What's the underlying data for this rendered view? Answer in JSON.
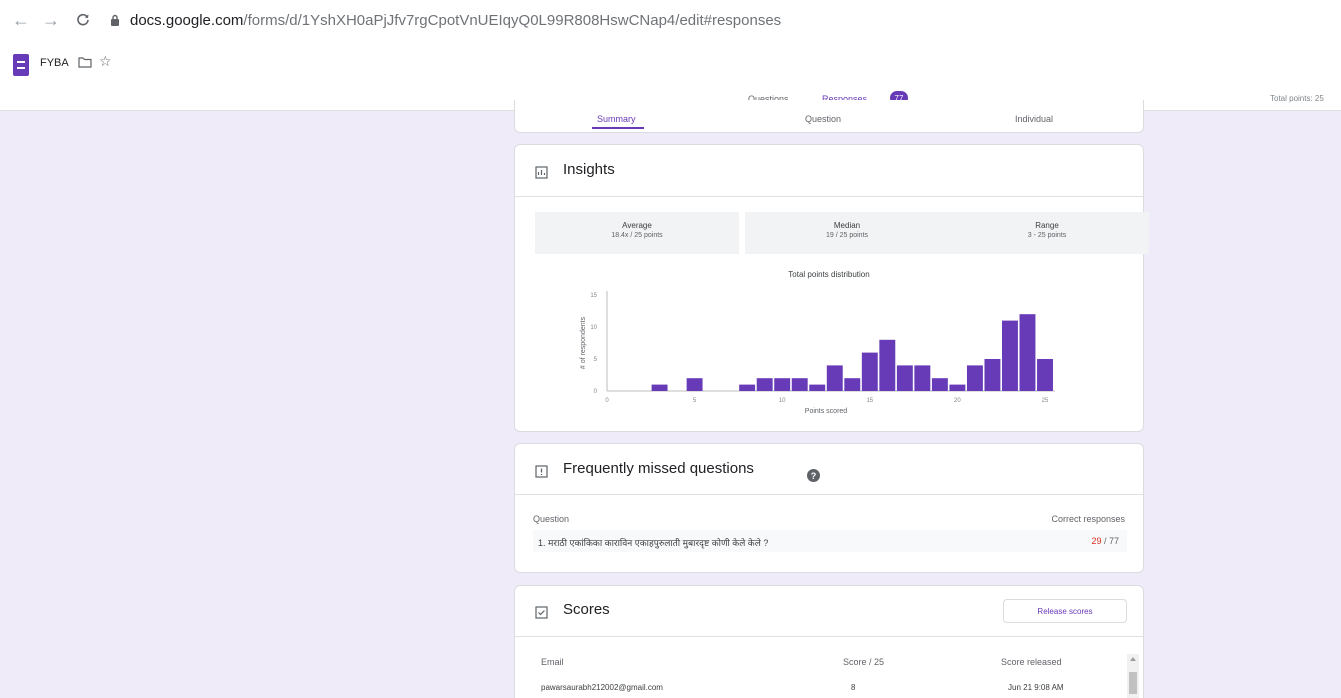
{
  "browser": {
    "url_domain": "docs.google.com",
    "url_path": "/forms/d/1YshXH0aPjJfv7rgCpotVnUEIqyQ0L99R808HswCNap4/edit#responses"
  },
  "header": {
    "form_title": "FYBA",
    "tabs": {
      "questions": "Questions",
      "responses": "Responses",
      "responses_count": "77"
    },
    "total_points": "Total points: 25"
  },
  "subtabs": [
    "Summary",
    "Question",
    "Individual"
  ],
  "insights": {
    "title": "Insights",
    "stats": [
      {
        "label": "Average",
        "value": "18.4x / 25 points"
      },
      {
        "label": "Median",
        "value": "19 / 25 points"
      },
      {
        "label": "Range",
        "value": "3 - 25 points"
      }
    ]
  },
  "chart_data": {
    "type": "bar",
    "title": "Total points distribution",
    "xlabel": "Points scored",
    "ylabel": "# of respondents",
    "xlim": [
      0,
      25
    ],
    "ylim": [
      0,
      15
    ],
    "xticks": [
      0,
      5,
      10,
      15,
      20,
      25
    ],
    "yticks": [
      0,
      5,
      10,
      15
    ],
    "x": [
      3,
      5,
      8,
      9,
      10,
      11,
      12,
      13,
      14,
      15,
      16,
      17,
      18,
      19,
      20,
      21,
      22,
      23,
      24,
      25
    ],
    "values": [
      1,
      2,
      1,
      2,
      2,
      2,
      1,
      4,
      2,
      6,
      8,
      4,
      4,
      2,
      1,
      4,
      5,
      11,
      12,
      5
    ],
    "bar_color": "#673ab7",
    "grid": false
  },
  "missed": {
    "title": "Frequently missed questions",
    "col_question": "Question",
    "col_correct": "Correct responses",
    "question_text": "1. मराठी एकांकिका काराविन एकाहपुरुलाती मुबारदृष्ट कोणी केले केले ?",
    "correct_num": "29",
    "correct_total": " / 77"
  },
  "scores": {
    "title": "Scores",
    "release_label": "Release scores",
    "col_email": "Email",
    "col_score": "Score / 25",
    "col_released": "Score released",
    "rows": [
      {
        "email": "pawarsaurabh212002@gmail.com",
        "score": "8",
        "released": "Jun 21 9:08 AM"
      }
    ]
  },
  "colors": {
    "accent": "#673ab7",
    "background": "#f0ebf8"
  }
}
